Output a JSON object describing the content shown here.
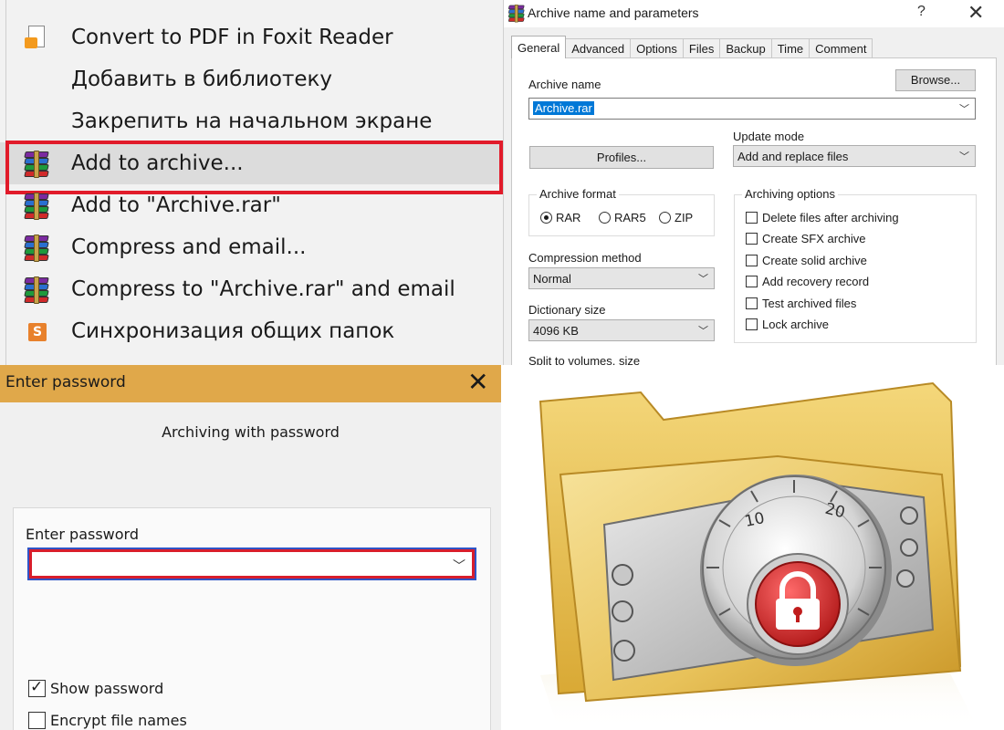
{
  "context_menu": {
    "items": [
      {
        "label": "Convert to PDF in Foxit Reader",
        "icon": "foxit-pdf-icon"
      },
      {
        "label": "Добавить в библиотеку",
        "icon": ""
      },
      {
        "label": "Закрепить на начальном экране",
        "icon": ""
      },
      {
        "label": "Add to archive...",
        "icon": "winrar-icon",
        "highlighted": true
      },
      {
        "label": "Add to \"Archive.rar\"",
        "icon": "winrar-icon"
      },
      {
        "label": "Compress and email...",
        "icon": "winrar-icon"
      },
      {
        "label": "Compress to \"Archive.rar\" and email",
        "icon": "winrar-icon"
      },
      {
        "label": "Синхронизация общих папок",
        "icon": "sync-icon"
      }
    ],
    "highlight_color": "#e11b2a"
  },
  "archive_dialog": {
    "title": "Archive name and parameters",
    "help_glyph": "?",
    "close_glyph": "✕",
    "tabs": [
      "General",
      "Advanced",
      "Options",
      "Files",
      "Backup",
      "Time",
      "Comment"
    ],
    "active_tab": "General",
    "archive_name_label": "Archive name",
    "archive_name_value": "Archive.rar",
    "browse_label": "Browse...",
    "profiles_label": "Profiles...",
    "update_mode_label": "Update mode",
    "update_mode_value": "Add and replace files",
    "archive_format_label": "Archive format",
    "formats": [
      {
        "label": "RAR",
        "selected": true
      },
      {
        "label": "RAR5",
        "selected": false
      },
      {
        "label": "ZIP",
        "selected": false
      }
    ],
    "compression_method_label": "Compression method",
    "compression_method_value": "Normal",
    "dictionary_size_label": "Dictionary size",
    "dictionary_size_value": "4096 KB",
    "split_label": "Split to volumes, size",
    "archiving_options_label": "Archiving options",
    "options": [
      {
        "label": "Delete files after archiving",
        "checked": false
      },
      {
        "label": "Create SFX archive",
        "checked": false
      },
      {
        "label": "Create solid archive",
        "checked": false
      },
      {
        "label": "Add recovery record",
        "checked": false
      },
      {
        "label": "Test archived files",
        "checked": false
      },
      {
        "label": "Lock archive",
        "checked": false
      }
    ]
  },
  "password_dialog": {
    "title": "Enter password",
    "close_glyph": "✕",
    "subtitle": "Archiving with password",
    "field_label": "Enter password",
    "field_value": "",
    "show_password_label": "Show password",
    "show_password_checked": true,
    "encrypt_names_label": "Encrypt file names",
    "encrypt_names_checked": false,
    "titlebar_color": "#e0a84a"
  },
  "illustration": {
    "subject": "locked-folder-icon",
    "dial_numbers": [
      "10",
      "20"
    ]
  }
}
